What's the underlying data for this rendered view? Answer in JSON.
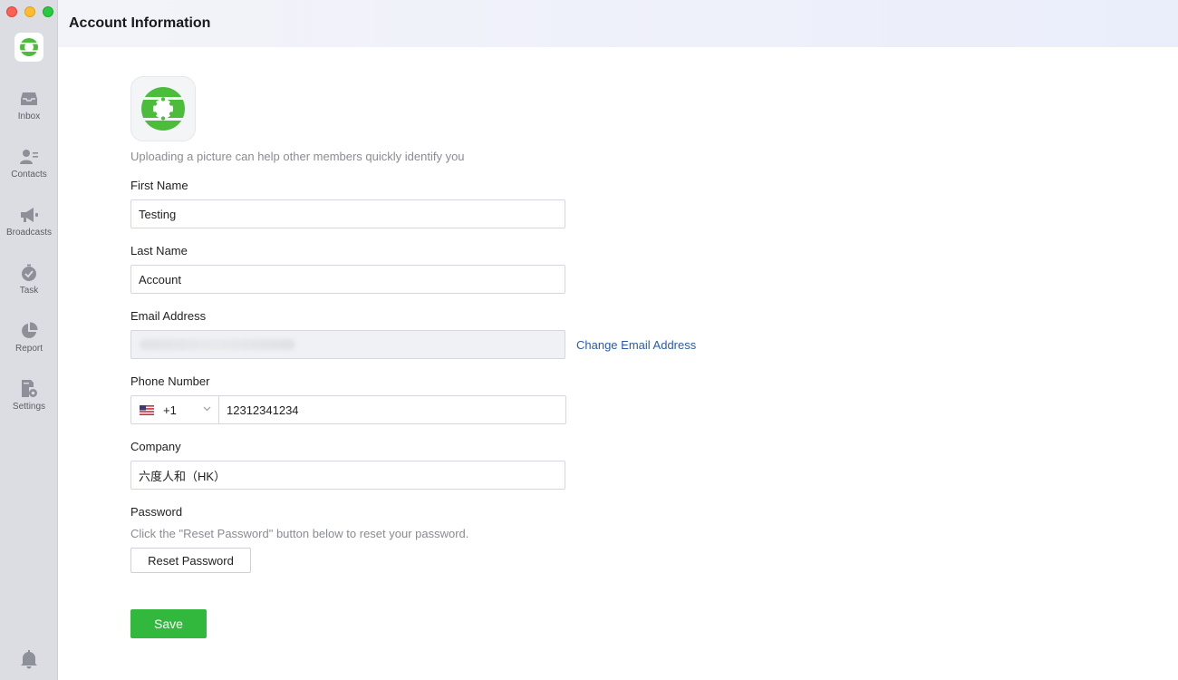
{
  "window": {
    "title": "Account Information"
  },
  "sidebar": {
    "logo_icon": "app-logo-icon",
    "items": [
      {
        "label": "Inbox",
        "icon": "inbox-icon"
      },
      {
        "label": "Contacts",
        "icon": "contacts-icon"
      },
      {
        "label": "Broadcasts",
        "icon": "megaphone-icon"
      },
      {
        "label": "Task",
        "icon": "check-circle-icon"
      },
      {
        "label": "Report",
        "icon": "pie-chart-icon"
      },
      {
        "label": "Settings",
        "icon": "settings-icon"
      }
    ],
    "bottom_icon": "bell-icon"
  },
  "form": {
    "avatar_hint": "Uploading a picture can help other members quickly identify you",
    "first_name": {
      "label": "First Name",
      "value": "Testing"
    },
    "last_name": {
      "label": "Last Name",
      "value": "Account"
    },
    "email": {
      "label": "Email Address",
      "value": "",
      "change_link": "Change Email Address"
    },
    "phone": {
      "label": "Phone Number",
      "country_flag": "us-flag-icon",
      "dial_code": "+1",
      "value": "12312341234"
    },
    "company": {
      "label": "Company",
      "value": "六度人和（HK）"
    },
    "password": {
      "label": "Password",
      "hint": "Click the \"Reset Password\" button below to reset your password.",
      "reset_label": "Reset Password"
    },
    "save_label": "Save"
  },
  "colors": {
    "brand_green": "#32b93d",
    "link_blue": "#2c5aa8",
    "sidebar_bg": "#dcdde3"
  }
}
